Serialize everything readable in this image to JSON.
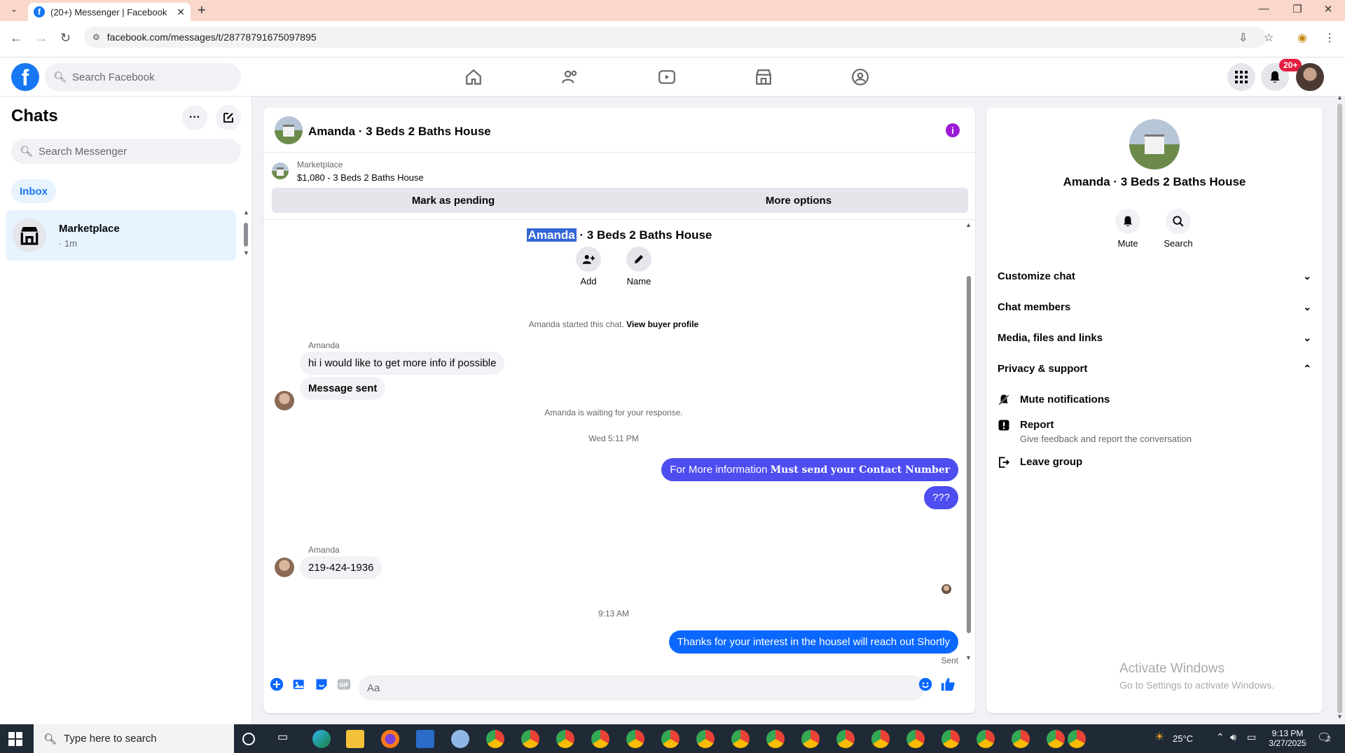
{
  "browser": {
    "tab_title": "(20+) Messenger | Facebook",
    "url": "facebook.com/messages/t/28778791675097895",
    "new_tab_label": "+"
  },
  "fb_header": {
    "search_placeholder": "Search Facebook",
    "notification_badge": "20+"
  },
  "sidebar": {
    "title": "Chats",
    "search_placeholder": "Search Messenger",
    "filter_label": "Inbox",
    "conversations": [
      {
        "name": "Marketplace",
        "subtitle": "· 1m"
      }
    ]
  },
  "chat": {
    "header_title": "Amanda · 3 Beds 2 Baths House",
    "marketplace_label": "Marketplace",
    "listing": "$1,080 - 3 Beds 2 Baths House",
    "mark_pending_label": "Mark as pending",
    "more_options_label": "More options",
    "convo_title_name": "Amanda",
    "convo_title_rest": " · 3 Beds 2 Baths House",
    "add_label": "Add",
    "name_label": "Name",
    "started_text": "Amanda started this chat.",
    "view_profile_label": "View buyer profile",
    "messages": [
      {
        "sender": "Amanda",
        "text": "hi i would like to get more info if possible"
      },
      {
        "text": "Message sent"
      },
      {
        "system": "Amanda is waiting for your response."
      },
      {
        "timestamp": "Wed 5:11 PM"
      },
      {
        "outgoing": true,
        "text_prefix": "For More information ",
        "text_bold": "Must send your Contact Number"
      },
      {
        "outgoing": true,
        "text": "???"
      },
      {
        "sender": "Amanda",
        "text": "219-424-1936"
      },
      {
        "timestamp": "9:13 AM"
      },
      {
        "outgoing": true,
        "text": "Thanks for your interest in the housel will reach out Shortly",
        "status": "Sent"
      }
    ],
    "composer_placeholder": "Aa"
  },
  "info_panel": {
    "name": "Amanda · 3 Beds 2 Baths House",
    "mute_label": "Mute",
    "search_label": "Search",
    "sections": [
      "Customize chat",
      "Chat members",
      "Media, files and links",
      "Privacy & support"
    ],
    "mute_notifications": "Mute notifications",
    "report_title": "Report",
    "report_desc": "Give feedback and report the conversation",
    "leave_group": "Leave group"
  },
  "watermark": {
    "line1": "Activate Windows",
    "line2": "Go to Settings to activate Windows."
  },
  "taskbar": {
    "search_placeholder": "Type here to search",
    "temperature": "25°C",
    "time": "9:13 PM",
    "date": "3/27/2025",
    "notification_count": "2"
  },
  "colors": {
    "fb_blue": "#1877f2",
    "outgoing_bubble": "#4e4df0",
    "outgoing_bubble_latest": "#0a68ff",
    "selection_highlight": "#3367d6",
    "info_purple": "#9b1bd6"
  }
}
